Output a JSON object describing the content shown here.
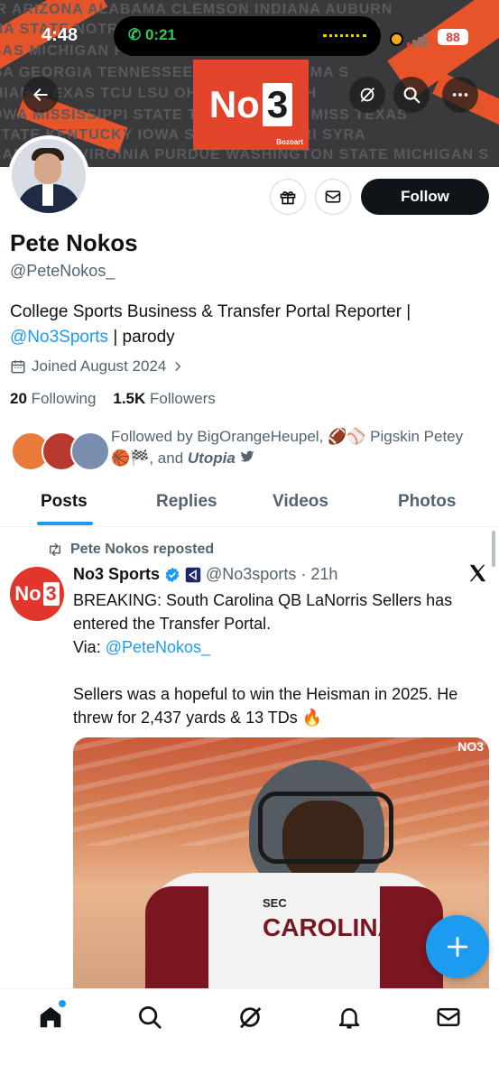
{
  "status_bar": {
    "time": "4:48",
    "call_time": "0:21",
    "battery": "88"
  },
  "banner": {
    "logo_text": "No",
    "logo_number": "3",
    "logo_sub": "Bozoart",
    "background_words": [
      "IR  ARIZONA  ALABAMA  CLEMSON  INDIANA  AUBURN",
      "MA STATE  NOTRE DAME  OLE  ARKANSAS  BAYLOR",
      "BAS  MICHIGAN  FLORIDA  IOWA  OREGON  ARYLA",
      "GA  GEORGIA  TENNESSEE  TATE  OKLAHOMA S",
      "MIAMI  TEXAS  TCU  LSU  OHIO STATE  UTAH",
      "OWA  MISSISSIPPI STATE  TECH  USC  OLE MISS  TEXAS",
      "STATE  KENTUCKY  IOWA STATE  MISSOURI  SYRA",
      "CAROLINA  VIRGINIA  PURDUE  WASHINGTON STATE  MICHIGAN S"
    ]
  },
  "profile": {
    "name": "Pete Nokos",
    "handle": "@PeteNokos_",
    "bio_prefix": "College Sports Business & Transfer Portal Reporter |",
    "bio_link": "@No3Sports",
    "bio_suffix": "| parody",
    "joined": "Joined August 2024",
    "following_count": "20",
    "following_label": "Following",
    "followers_count": "1.5K",
    "followers_label": "Followers",
    "follow_button": "Follow",
    "followed_by": {
      "prefix": "Followed by BigOrangeHeupel,",
      "emoji_1": "🏈⚾",
      "name_2": "Pigskin Petey",
      "emoji_2": "🏀🏁",
      "and_text": ", and",
      "name_3": "Utopia"
    }
  },
  "tabs": [
    "Posts",
    "Replies",
    "Videos",
    "Photos"
  ],
  "post": {
    "repost_label": "Pete Nokos reposted",
    "author": "No3 Sports",
    "author_handle": "@No3sports",
    "time": "21h",
    "line1": "BREAKING: South Carolina QB LaNorris Sellers has entered the Transfer Portal.",
    "via_label": "Via:",
    "via_link": "@PeteNokos_",
    "line2": "Sellers was a hopeful to win the Heisman in 2025. He threw for 2,437 yards & 13 TDs 🔥",
    "image_watermark": "NO3",
    "jersey_text": "CAROLINA",
    "jersey_badge": "SEC",
    "avatar_text": "No",
    "avatar_num": "3"
  },
  "colors": {
    "accent": "#1d9bf0",
    "brand_red": "#e2452b",
    "text": "#0f1419",
    "muted": "#536471"
  }
}
